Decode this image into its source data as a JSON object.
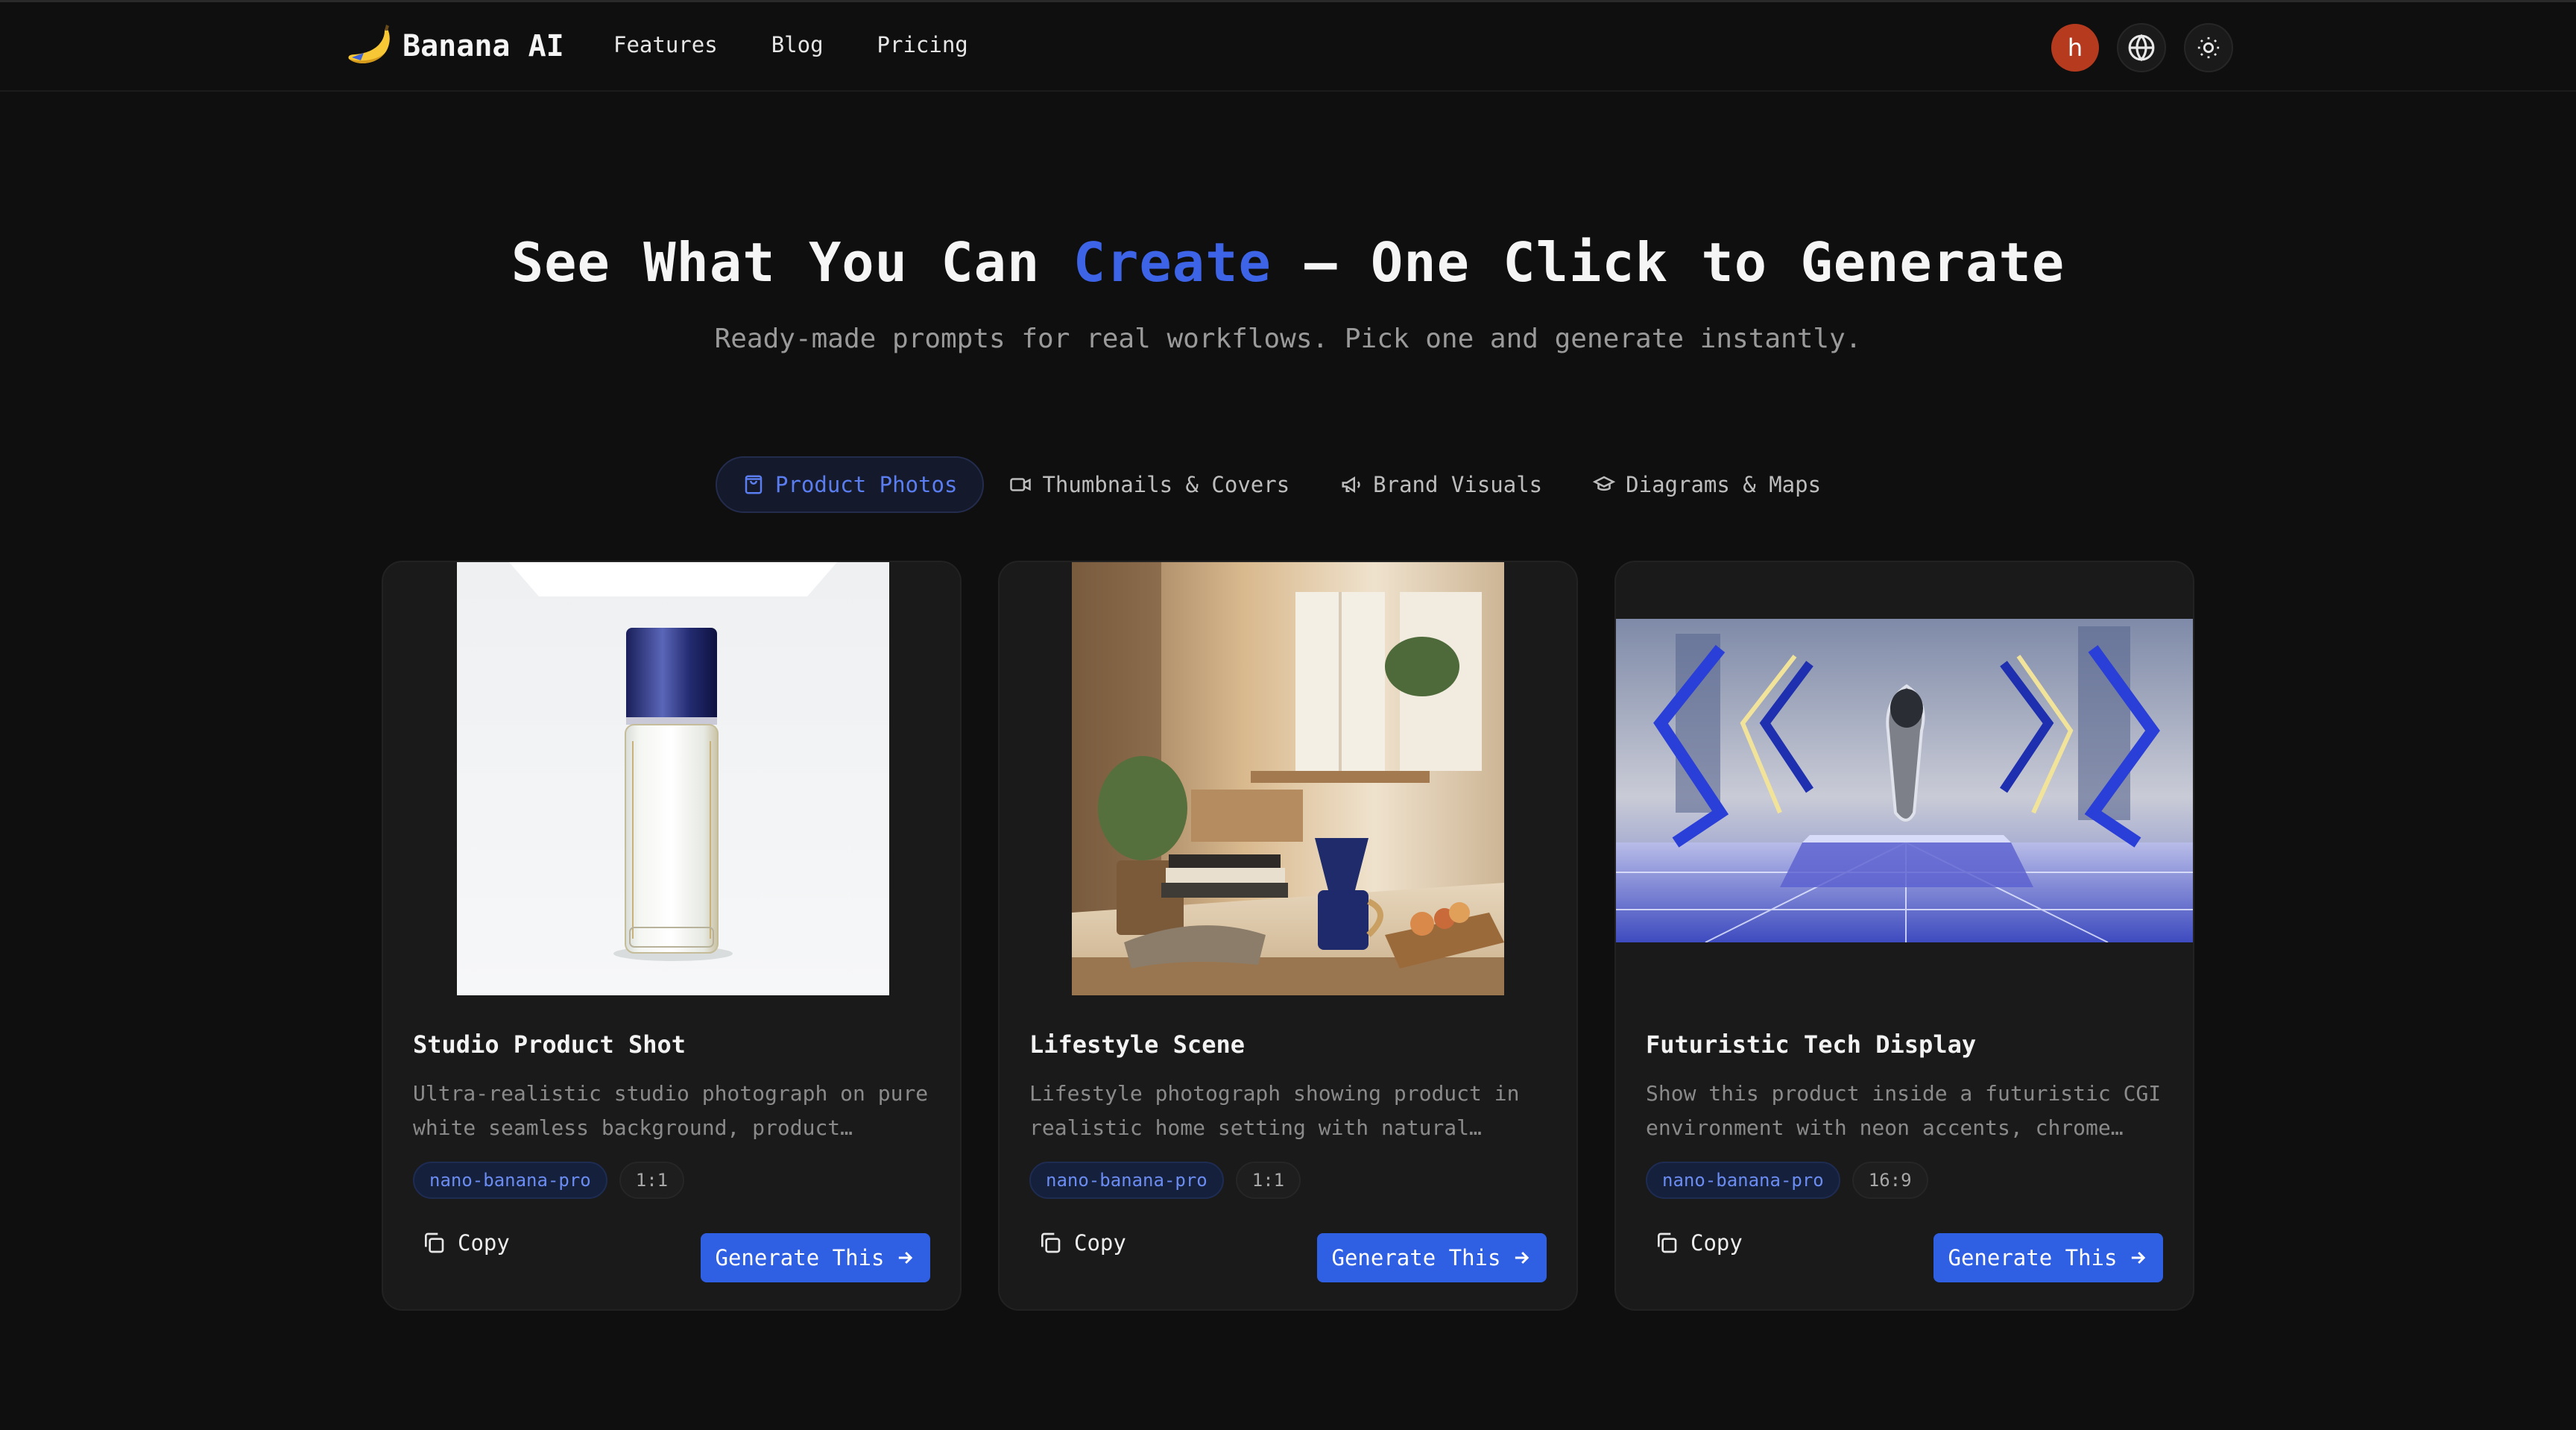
{
  "nav": {
    "brand": "Banana AI",
    "links": [
      "Features",
      "Blog",
      "Pricing"
    ],
    "avatar_letter": "h",
    "globe_icon": "globe-icon",
    "theme_icon": "sun-icon"
  },
  "hero": {
    "title_before": "See What You Can ",
    "title_accent": "Create",
    "title_after": " — One Click to Generate",
    "subtitle": "Ready-made prompts for real workflows. Pick one and generate instantly."
  },
  "tabs": [
    {
      "label": "Product Photos",
      "icon": "shopping-bag-icon",
      "active": true
    },
    {
      "label": "Thumbnails & Covers",
      "icon": "video-camera-icon",
      "active": false
    },
    {
      "label": "Brand Visuals",
      "icon": "megaphone-icon",
      "active": false
    },
    {
      "label": "Diagrams & Maps",
      "icon": "graduation-cap-icon",
      "active": false
    }
  ],
  "cards": [
    {
      "title": "Studio Product Shot",
      "description": "Ultra-realistic studio photograph on pure white seamless background, product…",
      "model": "nano-banana-pro",
      "ratio": "1:1",
      "copy_label": "Copy",
      "generate_label": "Generate This"
    },
    {
      "title": "Lifestyle Scene",
      "description": "Lifestyle photograph showing product in realistic home setting with natural…",
      "model": "nano-banana-pro",
      "ratio": "1:1",
      "copy_label": "Copy",
      "generate_label": "Generate This"
    },
    {
      "title": "Futuristic Tech Display",
      "description": "Show this product inside a futuristic CGI environment with neon accents, chrome…",
      "model": "nano-banana-pro",
      "ratio": "16:9",
      "copy_label": "Copy",
      "generate_label": "Generate This"
    }
  ],
  "colors": {
    "background": "#0f0f0f",
    "accent": "#3d63e6",
    "button": "#2f5fe3",
    "avatar": "#b63a1e"
  }
}
